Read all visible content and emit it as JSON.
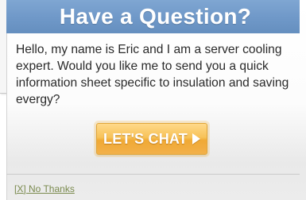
{
  "popup": {
    "title": "Have a Question?",
    "message": "Hello, my name is Eric and I am a server cooling expert.  Would you like me to send you a quick information sheet specific to insulation and saving evergy?",
    "chat_button_label": "LET'S CHAT",
    "chat_button_icon": "play-arrow-icon",
    "dismiss_label": "[X] No Thanks"
  },
  "colors": {
    "header_blue": "#6f98c8",
    "button_orange": "#f0a934",
    "link_olive": "#7a8a4e",
    "text_dark": "#2a2a2a"
  }
}
